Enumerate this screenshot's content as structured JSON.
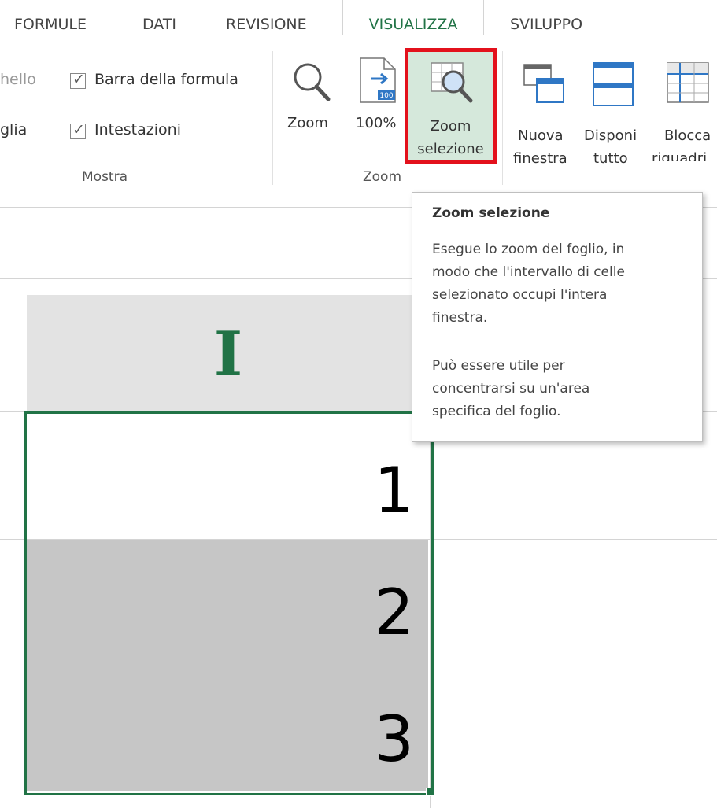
{
  "tabs": {
    "formule": "FORMULE",
    "dati": "DATI",
    "revisione": "REVISIONE",
    "visualizza": "VISUALIZZA",
    "sviluppo": "SVILUPPO"
  },
  "show_group": {
    "label": "Mostra",
    "items": [
      {
        "label": "Barra della formula",
        "checked": true
      },
      {
        "label": "Intestazioni",
        "checked": true
      }
    ],
    "cut_items": [
      "hello",
      "glia"
    ]
  },
  "zoom_group": {
    "label": "Zoom",
    "zoom": "Zoom",
    "zoom100": "100%",
    "zoom_sel_line1": "Zoom",
    "zoom_sel_line2": "selezione",
    "icon_100": "100"
  },
  "window_group": {
    "new_window_line1": "Nuova",
    "new_window_line2": "finestra",
    "arrange_line1": "Disponi",
    "arrange_line2": "tutto",
    "freeze_line1": "Blocca",
    "freeze_line2": "riquadri"
  },
  "tooltip": {
    "title": "Zoom selezione",
    "lines1": [
      "Esegue lo zoom del foglio, in",
      "modo che l'intervallo di celle",
      "selezionato occupi l'intera",
      "finestra."
    ],
    "lines2": [
      "Può essere utile per",
      "concentrarsi su un'area",
      "specifica del foglio."
    ]
  },
  "sheet": {
    "column_header": "I",
    "cells": [
      "1",
      "2",
      "3"
    ]
  },
  "colors": {
    "accent": "#217346",
    "highlight_box": "#e3111c",
    "selected_fill": "#c6c6c6",
    "button_active": "#d5e8db"
  }
}
